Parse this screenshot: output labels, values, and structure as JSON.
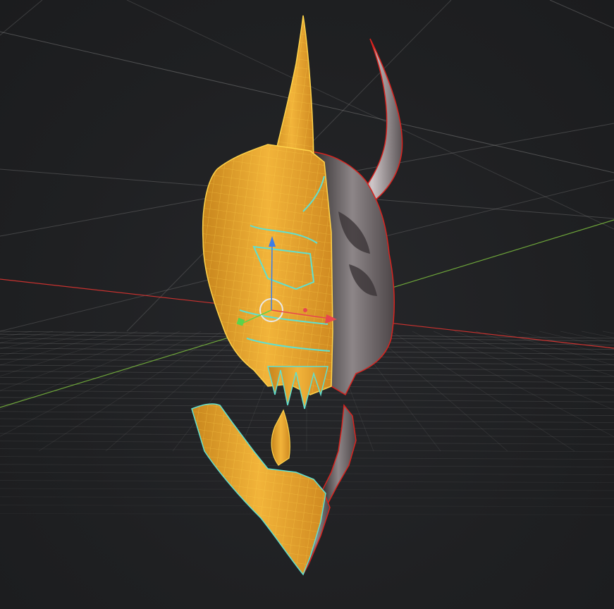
{
  "viewport": {
    "background": "#1e1f21",
    "grid_color": "#8a8a8a",
    "axis_x_color": "#c8322f",
    "axis_y_color": "#6da43a"
  },
  "gizmo": {
    "x_color": "#e8474e",
    "y_color": "#5bd34a",
    "z_color": "#3b7de8",
    "rotate_ring_color": "#e8e8e8"
  },
  "model": {
    "selected_fill": "#e8a32c",
    "selected_wire": "#ffd34a",
    "seam_color": "#5fe0d0",
    "unselected_fill": "#6a6466",
    "outline_color": "#d8231f"
  },
  "icons": {
    "move_gizmo": "move-gizmo-icon",
    "rotate_gizmo": "rotate-gizmo-icon"
  }
}
